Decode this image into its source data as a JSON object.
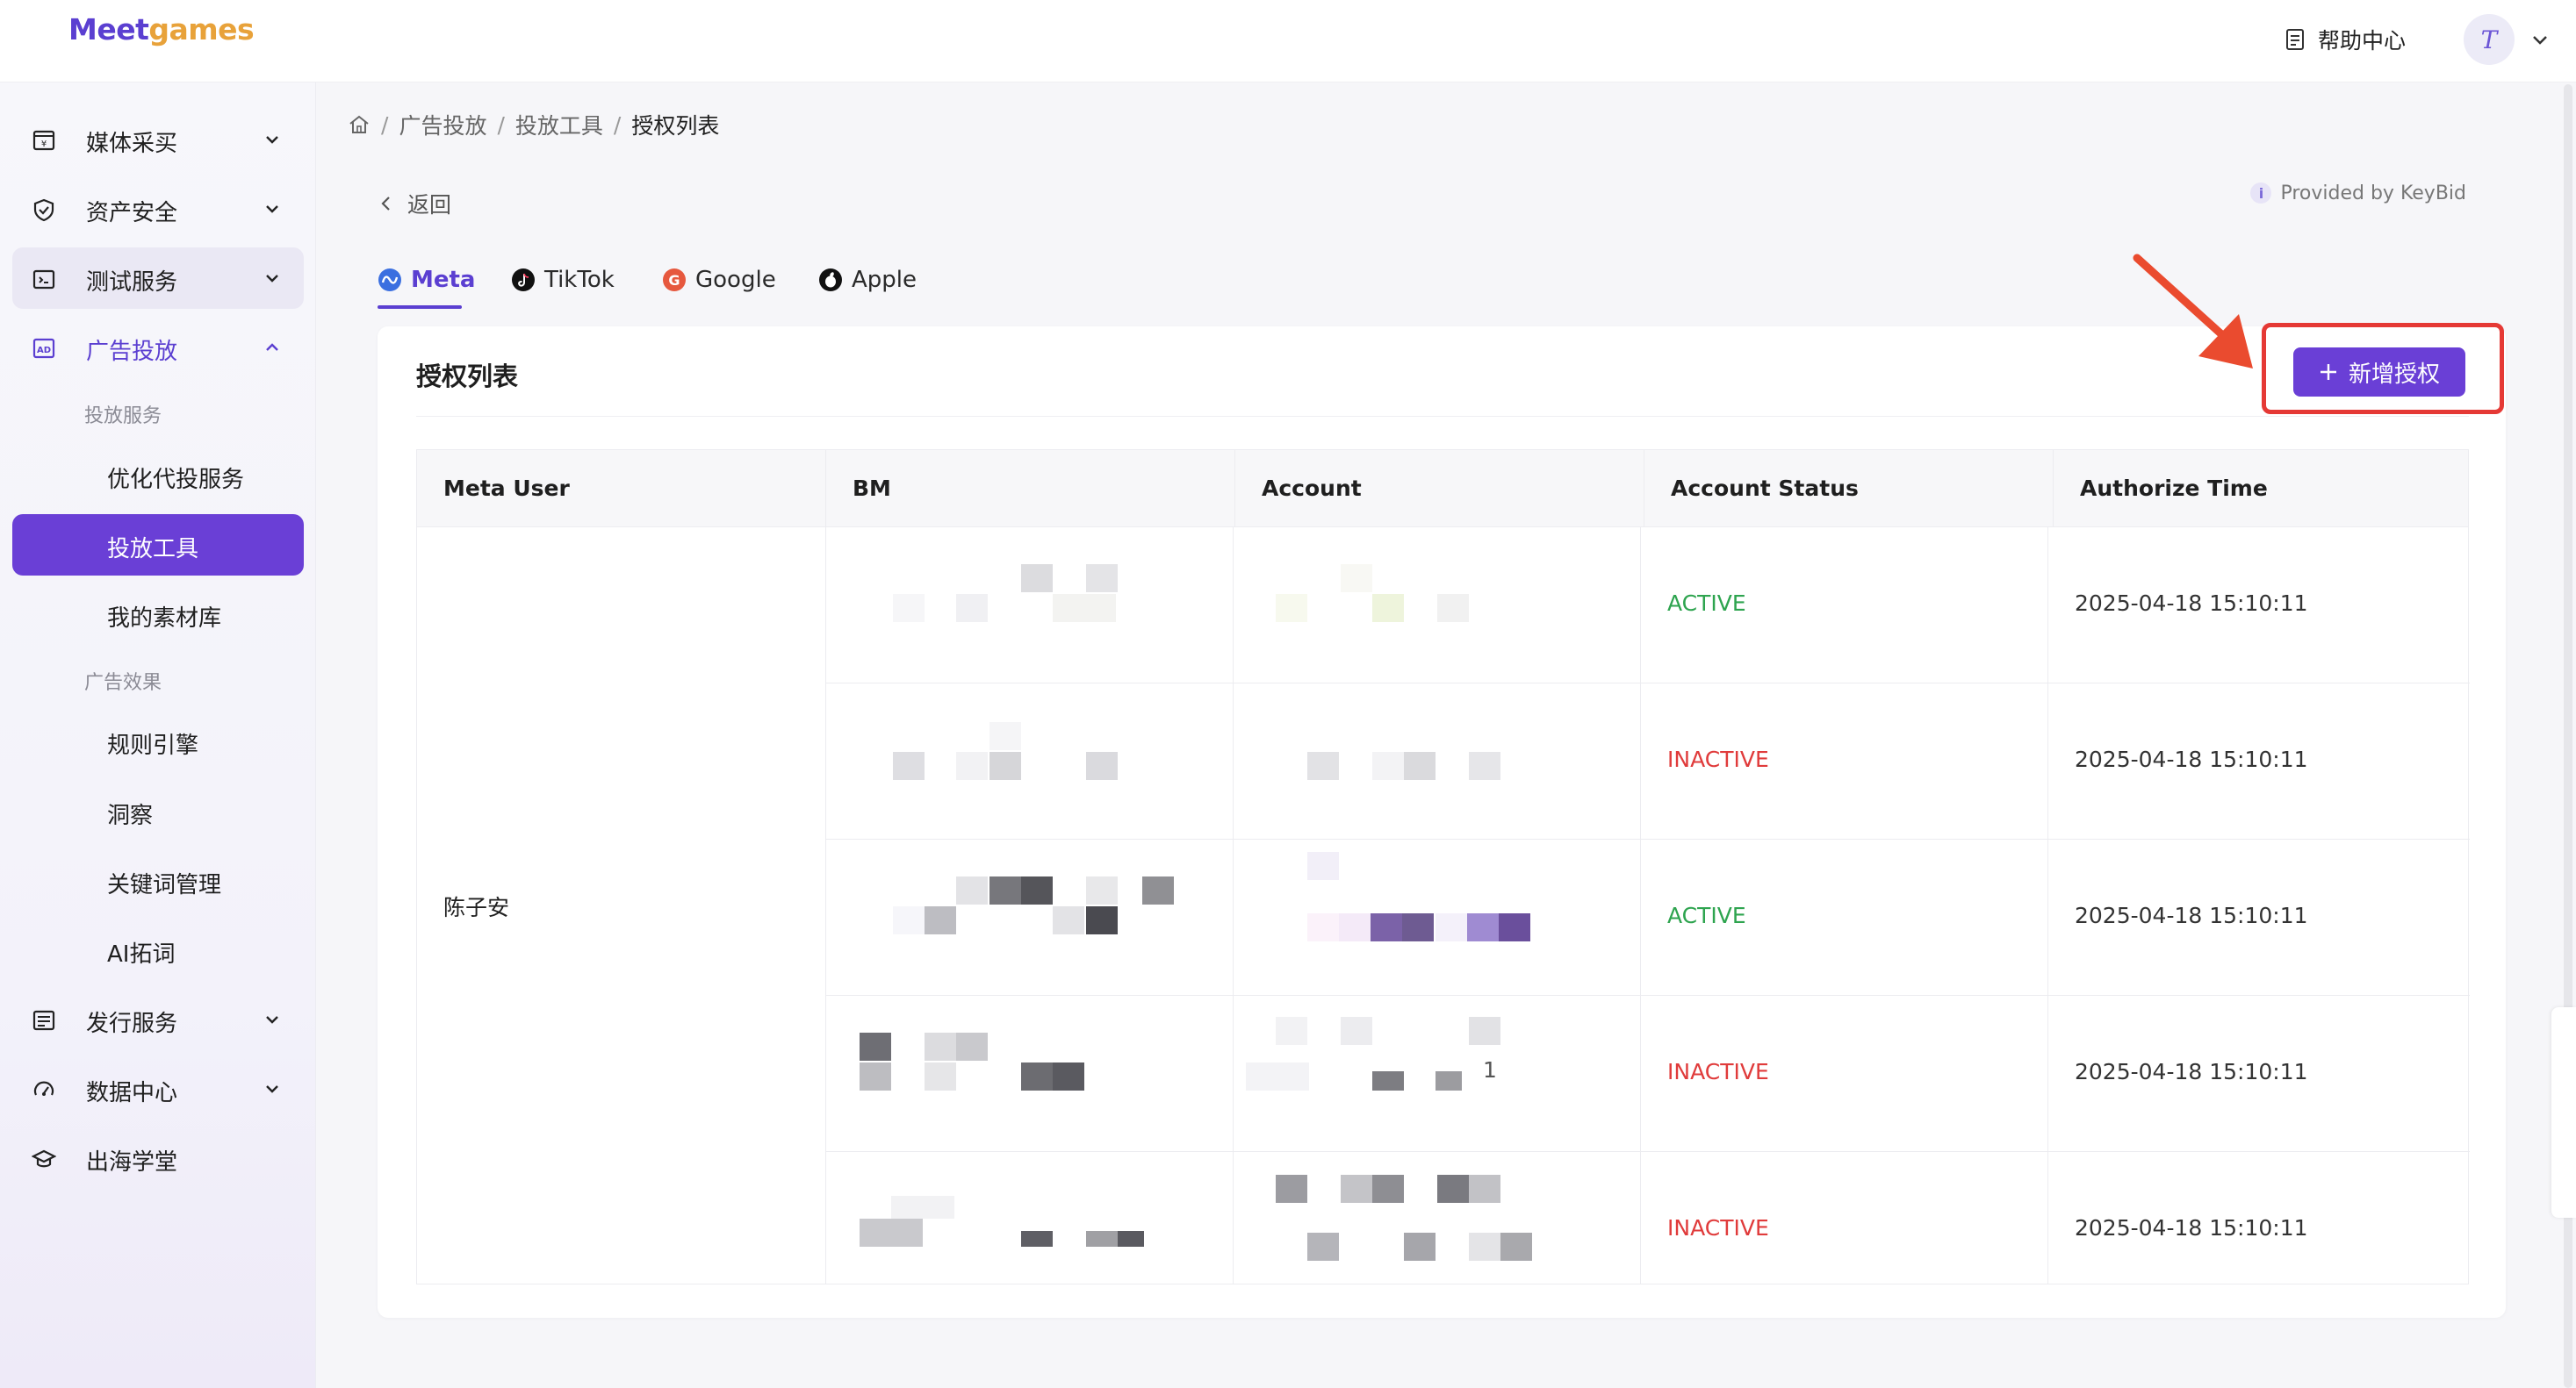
{
  "header": {
    "logo_part1": "Meet",
    "logo_part2": "games",
    "help_label": "帮助中心",
    "avatar_letter": "T"
  },
  "sidebar": {
    "items": [
      {
        "label": "媒体采买",
        "icon": "media-buy-icon"
      },
      {
        "label": "资产安全",
        "icon": "shield-icon"
      },
      {
        "label": "测试服务",
        "icon": "folder-test-icon"
      },
      {
        "label": "广告投放",
        "icon": "ad-icon"
      },
      {
        "label": "发行服务",
        "icon": "publish-icon"
      },
      {
        "label": "数据中心",
        "icon": "data-icon"
      },
      {
        "label": "出海学堂",
        "icon": "graduation-cap-icon"
      }
    ],
    "group1_label": "投放服务",
    "group2_label": "广告效果",
    "sub_items": [
      {
        "label": "优化代投服务"
      },
      {
        "label": "投放工具"
      },
      {
        "label": "我的素材库"
      },
      {
        "label": "规则引擎"
      },
      {
        "label": "洞察"
      },
      {
        "label": "关键词管理"
      },
      {
        "label": "AI拓词"
      }
    ]
  },
  "breadcrumb": {
    "items": [
      "广告投放",
      "投放工具",
      "授权列表"
    ],
    "sep": "/"
  },
  "back_label": "返回",
  "provided_by": "Provided by KeyBid",
  "tabs": [
    {
      "label": "Meta"
    },
    {
      "label": "TikTok"
    },
    {
      "label": "Google"
    },
    {
      "label": "Apple"
    }
  ],
  "card": {
    "title": "授权列表",
    "add_button": "新增授权"
  },
  "table": {
    "columns": [
      "Meta User",
      "BM",
      "Account",
      "Account Status",
      "Authorize Time"
    ],
    "meta_user": "陈子安",
    "rows": [
      {
        "status": "ACTIVE",
        "time": "2025-04-18 15:10:11"
      },
      {
        "status": "INACTIVE",
        "time": "2025-04-18 15:10:11"
      },
      {
        "status": "ACTIVE",
        "time": "2025-04-18 15:10:11"
      },
      {
        "status": "INACTIVE",
        "time": "2025-04-18 15:10:11",
        "account_suffix": "1"
      },
      {
        "status": "INACTIVE",
        "time": "2025-04-18 15:10:11"
      }
    ]
  },
  "colors": {
    "brand": "#6a3fd6",
    "active": "#2ea44f",
    "inactive": "#e03b3b",
    "highlight": "#e53935"
  }
}
